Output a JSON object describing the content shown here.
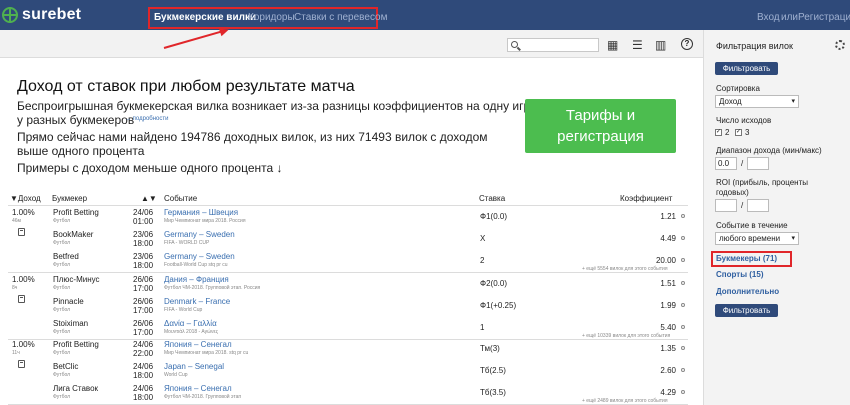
{
  "header": {
    "logo": "surebet",
    "nav": [
      "Букмекерские вилки",
      "Коридоры",
      "Ставки с перевесом"
    ],
    "login": "Вход",
    "or": "или",
    "register": "Регистрация"
  },
  "toolbar": {
    "icons": [
      "search-icon",
      "calculator-icon",
      "list-icon",
      "swap-icon",
      "chart-icon",
      "help-icon"
    ],
    "help_glyph": "?"
  },
  "banner": {
    "title": "Доход от ставок при любом результате матча",
    "line1": "Беспроигрышная букмекерская вилка возникает из-за разницы коэффициентов на одну игру",
    "line2": "у разных букмекеров",
    "more": "→ подробности",
    "line3": "Прямо сейчас нами найдено 194786 доходных вилок, из них 71493 вилок с доходом",
    "line4": "выше одного процента",
    "line5": "Примеры с доходом меньше одного процента ↓",
    "cta_line1": "Тарифы и",
    "cta_line2": "регистрация"
  },
  "table": {
    "headers": {
      "profit": "▼Доход",
      "bookmaker": "Букмекер",
      "sort": "▲▼",
      "event": "Событие",
      "bet": "Ставка",
      "coef": "Коэффициент"
    },
    "groups": [
      {
        "profit": "1.00%",
        "age": "46м",
        "rows": [
          {
            "bookmaker": "Profit Betting",
            "sport": "Футбол",
            "date": "24/06",
            "time": "01:00",
            "event": "Германия – Швеция",
            "league": "Мир Чемпионат мира 2018. Россия",
            "bet": "Ф1(0.0)",
            "coef": "1.21"
          },
          {
            "bookmaker": "BookMaker",
            "sport": "Футбол",
            "date": "23/06",
            "time": "18:00",
            "event": "Germany – Sweden",
            "league": "FIFA - WORLD CUP",
            "bet": "X",
            "coef": "4.49"
          },
          {
            "bookmaker": "Betfred",
            "sport": "Футбол",
            "date": "23/06",
            "time": "18:00",
            "event": "Germany – Sweden",
            "league": "Football-World Cup stq pr cu",
            "bet": "2",
            "coef": "20.00"
          }
        ],
        "more": "+ ещё 5554 вилок для этого события"
      },
      {
        "profit": "1.00%",
        "age": "8ч",
        "rows": [
          {
            "bookmaker": "Плюс-Минус",
            "sport": "Футбол",
            "date": "26/06",
            "time": "17:00",
            "event": "Дания – Франция",
            "league": "Футбол ЧМ-2018. Групповой этап. Россия",
            "bet": "Ф2(0.0)",
            "coef": "1.51"
          },
          {
            "bookmaker": "Pinnacle",
            "sport": "Футбол",
            "date": "26/06",
            "time": "17:00",
            "event": "Denmark – France",
            "league": "FIFA - World Cup",
            "bet": "Ф1(+0.25)",
            "coef": "1.99"
          },
          {
            "bookmaker": "Stoiximan",
            "sport": "Футбол",
            "date": "26/06",
            "time": "17:00",
            "event": "Δανία – Γαλλία",
            "league": "Μουντιάλ 2018 - Αγώνες",
            "bet": "1",
            "coef": "5.40"
          }
        ],
        "more": "+ ещё 10339 вилок для этого события"
      },
      {
        "profit": "1.00%",
        "age": "11ч",
        "rows": [
          {
            "bookmaker": "Profit Betting",
            "sport": "Футбол",
            "date": "24/06",
            "time": "22:00",
            "event": "Япония – Сенегал",
            "league": "Мир Чемпионат мира 2018. stq pr cu",
            "bet": "Тм(3)",
            "coef": "1.35"
          },
          {
            "bookmaker": "BetClic",
            "sport": "Футбол",
            "date": "24/06",
            "time": "18:00",
            "event": "Japan – Senegal",
            "league": "World Cup",
            "bet": "Тб(2.5)",
            "coef": "2.60"
          },
          {
            "bookmaker": "Лига Ставок",
            "sport": "Футбол",
            "date": "24/06",
            "time": "18:00",
            "event": "Япония – Сенегал",
            "league": "Футбол ЧМ-2018. Групповой этап",
            "bet": "Тб(3.5)",
            "coef": "4.29"
          }
        ],
        "more": "+ ещё 2489 вилок для этого события"
      }
    ]
  },
  "sidebar": {
    "title": "Фильтрация вилок",
    "filter_btn": "Фильтровать",
    "sort_label": "Сортировка",
    "sort_value": "Доход",
    "outcomes_label": "Число исходов",
    "outcome_2": "2",
    "outcome_3": "3",
    "check_glyph": "✓",
    "range_label": "Диапазон дохода (мин/макс)",
    "range_min": "0.0",
    "dash": "/",
    "roi_label_1": "ROI (прибыль, проценты",
    "roi_label_2": "годовых)",
    "within_label": "Событие в течение",
    "within_value": "любого времени",
    "bookmakers": "Букмекеры (71)",
    "sports": "Спорты (15)",
    "extra": "Дополнительно"
  }
}
